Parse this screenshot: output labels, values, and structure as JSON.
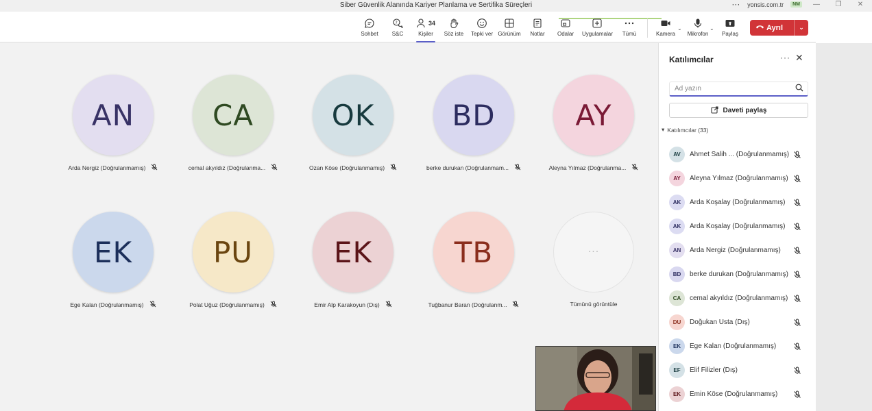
{
  "window": {
    "title": "Siber Güvenlik Alanında Kariyer Planlama ve Sertifika Süreçleri",
    "more": "···",
    "domain": "yonsis.com.tr",
    "account_initials": "NM"
  },
  "toolbar": {
    "chat": "Sohbet",
    "qa": "S&C",
    "people": "Kişiler",
    "people_count": "34",
    "raise_hand": "Söz iste",
    "react": "Tepki ver",
    "view": "Görünüm",
    "notes": "Notlar",
    "rooms": "Odalar",
    "apps": "Uygulamalar",
    "more": "Tümü",
    "camera": "Kamera",
    "mic": "Mikrofon",
    "share": "Paylaş",
    "leave": "Ayrıl"
  },
  "tiles": [
    {
      "initials": "AN",
      "name": "Arda Nergiz (Doğrulanmamış)",
      "bg": "#e3def0",
      "fg": "#383266"
    },
    {
      "initials": "CA",
      "name": "cemal akyıldız (Doğrulanma...",
      "bg": "#dde5d6",
      "fg": "#2f4a22"
    },
    {
      "initials": "OK",
      "name": "Ozan Köse (Doğrulanmamış)",
      "bg": "#d4e1e6",
      "fg": "#173a3e"
    },
    {
      "initials": "BD",
      "name": "berke durukan (Doğrulanmam...",
      "bg": "#d9d8f0",
      "fg": "#2c2c5f"
    },
    {
      "initials": "AY",
      "name": "Aleyna Yılmaz (Doğrulanma...",
      "bg": "#f4d5de",
      "fg": "#7a1a36"
    },
    {
      "initials": "EK",
      "name": "Ege Kalan (Doğrulanmamış)",
      "bg": "#cbd8ec",
      "fg": "#1c2f5a"
    },
    {
      "initials": "PU",
      "name": "Polat Uğuz (Doğrulanmamış)",
      "bg": "#f6e8c8",
      "fg": "#6a4510"
    },
    {
      "initials": "EK",
      "name": "Emir Alp Karakoyun (Dış)",
      "bg": "#ecd2d4",
      "fg": "#5b1418"
    },
    {
      "initials": "TB",
      "name": "Tuğbanur Baran (Doğrulanm...",
      "bg": "#f7d6d0",
      "fg": "#8a2d1c"
    }
  ],
  "more_tile": {
    "label": "Tümünü görüntüle",
    "dots": "···"
  },
  "panel": {
    "title": "Katılımcılar",
    "more": "···",
    "search_placeholder": "Ad yazın",
    "invite": "Daveti paylaş",
    "section": "Katılımcılar (33)",
    "people": [
      {
        "initials": "AV",
        "name": "Ahmet Salih ... (Doğrulanmamış)",
        "bg": "#d4e1e6",
        "fg": "#173a3e"
      },
      {
        "initials": "AY",
        "name": "Aleyna Yılmaz (Doğrulanmamış)",
        "bg": "#f4d5de",
        "fg": "#7a1a36"
      },
      {
        "initials": "AK",
        "name": "Arda Koşalay (Doğrulanmamış)",
        "bg": "#dcdcf2",
        "fg": "#2c2c5f"
      },
      {
        "initials": "AK",
        "name": "Arda Koşalay (Doğrulanmamış)",
        "bg": "#dcdcf2",
        "fg": "#2c2c5f"
      },
      {
        "initials": "AN",
        "name": "Arda Nergiz (Doğrulanmamış)",
        "bg": "#e3def0",
        "fg": "#383266"
      },
      {
        "initials": "BD",
        "name": "berke durukan (Doğrulanmamış)",
        "bg": "#d9d8f0",
        "fg": "#2c2c5f"
      },
      {
        "initials": "CA",
        "name": "cemal akyıldız (Doğrulanmamış)",
        "bg": "#dde5d6",
        "fg": "#2f4a22"
      },
      {
        "initials": "DU",
        "name": "Doğukan Usta (Dış)",
        "bg": "#f7d6d0",
        "fg": "#8a2d1c"
      },
      {
        "initials": "EK",
        "name": "Ege Kalan (Doğrulanmamış)",
        "bg": "#cbd8ec",
        "fg": "#1c2f5a"
      },
      {
        "initials": "EF",
        "name": "Elif Filizler (Dış)",
        "bg": "#d4e1e6",
        "fg": "#173a3e"
      },
      {
        "initials": "EK",
        "name": "Emin Köse (Doğrulanmamış)",
        "bg": "#ecd2d4",
        "fg": "#5b1418"
      }
    ]
  },
  "colors": {
    "accent": "#5b5fc7",
    "leave": "#d13438"
  }
}
